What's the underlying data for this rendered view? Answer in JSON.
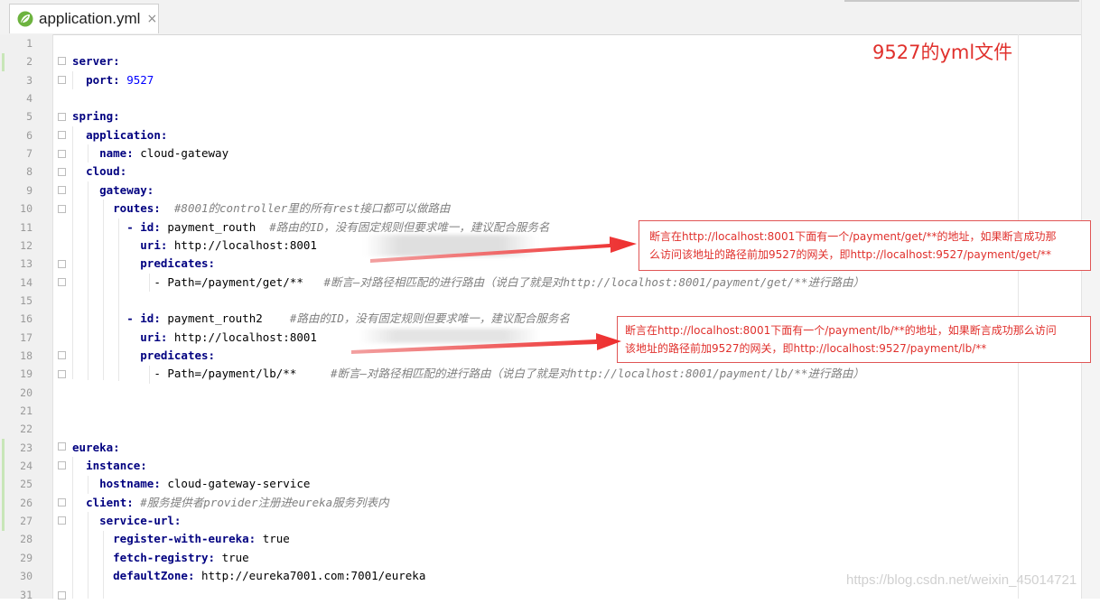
{
  "tab": {
    "title": "application.yml",
    "close_glyph": "×",
    "icon": "spring-leaf-icon"
  },
  "line_numbers": [
    "1",
    "2",
    "3",
    "4",
    "5",
    "6",
    "7",
    "8",
    "9",
    "10",
    "11",
    "12",
    "13",
    "14",
    "15",
    "16",
    "17",
    "18",
    "19",
    "20",
    "21",
    "22",
    "23",
    "24",
    "25",
    "26",
    "27",
    "28",
    "29",
    "30",
    "31"
  ],
  "code": {
    "l2_key": "server:",
    "l3_key": "port:",
    "l3_val": " 9527",
    "l5_key": "spring:",
    "l6_key": "application:",
    "l7_key": "name:",
    "l7_val": " cloud-gateway",
    "l8_key": "cloud:",
    "l9_key": "gateway:",
    "l10_key": "routes:",
    "l10_comment": "  #8001的controller里的所有rest接口都可以做路由",
    "l11_dash": "- ",
    "l11_key": "id:",
    "l11_val": " payment_routh",
    "l11_comment": "  #路由的ID，没有固定规则但要求唯一，建议配合服务名",
    "l12_key": "uri:",
    "l12_val": " http://localhost:8001",
    "l13_key": "predicates:",
    "l14_val": "- Path=/payment/get/**",
    "l14_comment": "   #断言—对路径相匹配的进行路由（说白了就是对http://localhost:8001/payment/get/**进行路由）",
    "l16_dash": "- ",
    "l16_key": "id:",
    "l16_val": " payment_routh2",
    "l16_comment": "    #路由的ID，没有固定规则但要求唯一，建议配合服务名",
    "l17_key": "uri:",
    "l17_val": " http://localhost:8001",
    "l18_key": "predicates:",
    "l19_val": "- Path=/payment/lb/**",
    "l19_comment": "     #断言—对路径相匹配的进行路由（说白了就是对http://localhost:8001/payment/lb/**进行路由）",
    "l23_key": "eureka:",
    "l24_key": "instance:",
    "l25_key": "hostname:",
    "l25_val": " cloud-gateway-service",
    "l26_key": "client:",
    "l26_comment": " #服务提供者provider注册进eureka服务列表内",
    "l27_key": "service-url:",
    "l28_key": "register-with-eureka:",
    "l28_val": " true",
    "l29_key": "fetch-registry:",
    "l29_val": " true",
    "l30_key": "defaultZone:",
    "l30_val": " http://eureka7001.com:7001/eureka"
  },
  "annotations": {
    "title": "9527的yml文件",
    "note1_line1": "断言在http://localhost:8001下面有一个/payment/get/**的地址，如果断言成功那",
    "note1_line2": "么访问该地址的路径前加9527的网关，即http://localhost:9527/payment/get/**",
    "note2_line1": "断言在http://localhost:8001下面有一个/payment/lb/**的地址，如果断言成功那么访问",
    "note2_line2": "该地址的路径前加9527的网关，即http://localhost:9527/payment/lb/**"
  },
  "watermark": "https://blog.csdn.net/weixin_45014721",
  "colors": {
    "key": "#000080",
    "number": "#0000ff",
    "comment": "#808080",
    "annotation": "#e0302c"
  }
}
